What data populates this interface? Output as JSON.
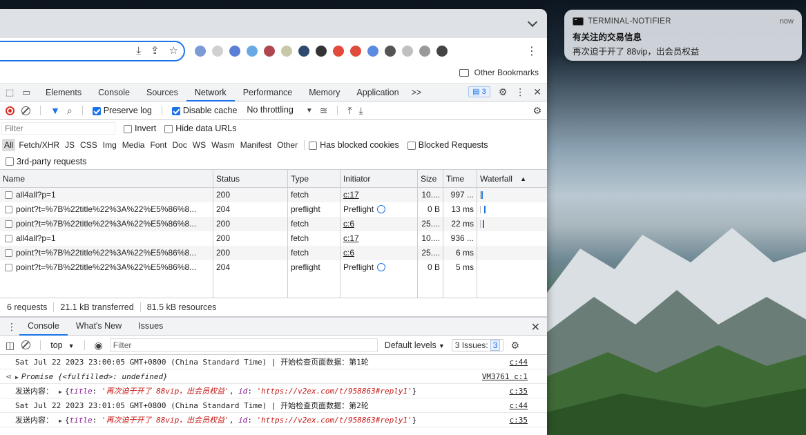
{
  "notification": {
    "app": "TERMINAL-NOTIFIER",
    "time": "now",
    "title": "有关注的交易信息",
    "body": "再次迫于开了 88vip，出会员权益"
  },
  "browser": {
    "bookmark_folder": "Other Bookmarks",
    "extension_colors": [
      "#7c9bd6",
      "#d0d0d0",
      "#5b7ed6",
      "#6aa9e6",
      "#b0464f",
      "#c8c8a8",
      "#2e4a6e",
      "#333333",
      "#e34a3b",
      "#e04b3b",
      "#5b8be0",
      "#555555",
      "#c0c0c0",
      "#999999",
      "#444444"
    ]
  },
  "devtools": {
    "tabs": [
      "Elements",
      "Console",
      "Sources",
      "Network",
      "Performance",
      "Memory",
      "Application"
    ],
    "active_tab": "Network",
    "more": ">>",
    "issues_count": "3",
    "network_toolbar": {
      "preserve_log": "Preserve log",
      "disable_cache": "Disable cache",
      "throttling": "No throttling"
    },
    "filter": {
      "placeholder": "Filter",
      "invert": "Invert",
      "hide_data_urls": "Hide data URLs"
    },
    "types": [
      "All",
      "Fetch/XHR",
      "JS",
      "CSS",
      "Img",
      "Media",
      "Font",
      "Doc",
      "WS",
      "Wasm",
      "Manifest",
      "Other"
    ],
    "has_blocked_cookies": "Has blocked cookies",
    "blocked_requests": "Blocked Requests",
    "third_party": "3rd-party requests",
    "columns": {
      "name": "Name",
      "status": "Status",
      "type": "Type",
      "initiator": "Initiator",
      "size": "Size",
      "time": "Time",
      "waterfall": "Waterfall"
    },
    "rows": [
      {
        "name": "all4all?p=1",
        "status": "200",
        "type": "fetch",
        "initiator": "c:17",
        "init_link": true,
        "size": "10....",
        "time": "997 ...",
        "wf": 6
      },
      {
        "name": "point?t=%7B%22title%22%3A%22%E5%86%8...",
        "status": "204",
        "type": "preflight",
        "initiator": "Preflight",
        "init_link": false,
        "size": "0 B",
        "time": "13 ms",
        "wf": 10
      },
      {
        "name": "point?t=%7B%22title%22%3A%22%E5%86%8...",
        "status": "200",
        "type": "fetch",
        "initiator": "c:6",
        "init_link": true,
        "size": "25....",
        "time": "22 ms",
        "wf": 8
      },
      {
        "name": "all4all?p=1",
        "status": "200",
        "type": "fetch",
        "initiator": "c:17",
        "init_link": true,
        "size": "10....",
        "time": "936 ...",
        "wf": null
      },
      {
        "name": "point?t=%7B%22title%22%3A%22%E5%86%8...",
        "status": "200",
        "type": "fetch",
        "initiator": "c:6",
        "init_link": true,
        "size": "25....",
        "time": "6 ms",
        "wf": null
      },
      {
        "name": "point?t=%7B%22title%22%3A%22%E5%86%8...",
        "status": "204",
        "type": "preflight",
        "initiator": "Preflight",
        "init_link": false,
        "size": "0 B",
        "time": "5 ms",
        "wf": null
      }
    ],
    "summary": {
      "requests": "6 requests",
      "transferred": "21.1 kB transferred",
      "resources": "81.5 kB resources"
    },
    "drawer_tabs": [
      "Console",
      "What's New",
      "Issues"
    ],
    "console_toolbar": {
      "context": "top",
      "filter_placeholder": "Filter",
      "levels": "Default levels",
      "issues_label": "3 Issues:",
      "issues_count": "3"
    },
    "logs": [
      {
        "kind": "text",
        "text": "Sat Jul 22 2023 23:00:05 GMT+0800 (China Standard Time) | 开始检查页面数据：第1轮",
        "src": "c:44"
      },
      {
        "kind": "promise",
        "prefix": "Promise",
        "body": "{<fulfilled>: undefined}",
        "src": "VM3761 c:1"
      },
      {
        "kind": "object",
        "label": "发送内容：",
        "title_key": "title",
        "title_val": "'再次迫于开了 88vip，出会员权益'",
        "id_key": "id",
        "id_val": "'https://v2ex.com/t/958863#reply1'",
        "src": "c:35"
      },
      {
        "kind": "text",
        "text": "Sat Jul 22 2023 23:01:05 GMT+0800 (China Standard Time) | 开始检查页面数据：第2轮",
        "src": "c:44"
      },
      {
        "kind": "object",
        "label": "发送内容：",
        "title_key": "title",
        "title_val": "'再次迫于开了 88vip，出会员权益'",
        "id_key": "id",
        "id_val": "'https://v2ex.com/t/958863#reply1'",
        "src": "c:35"
      }
    ]
  }
}
